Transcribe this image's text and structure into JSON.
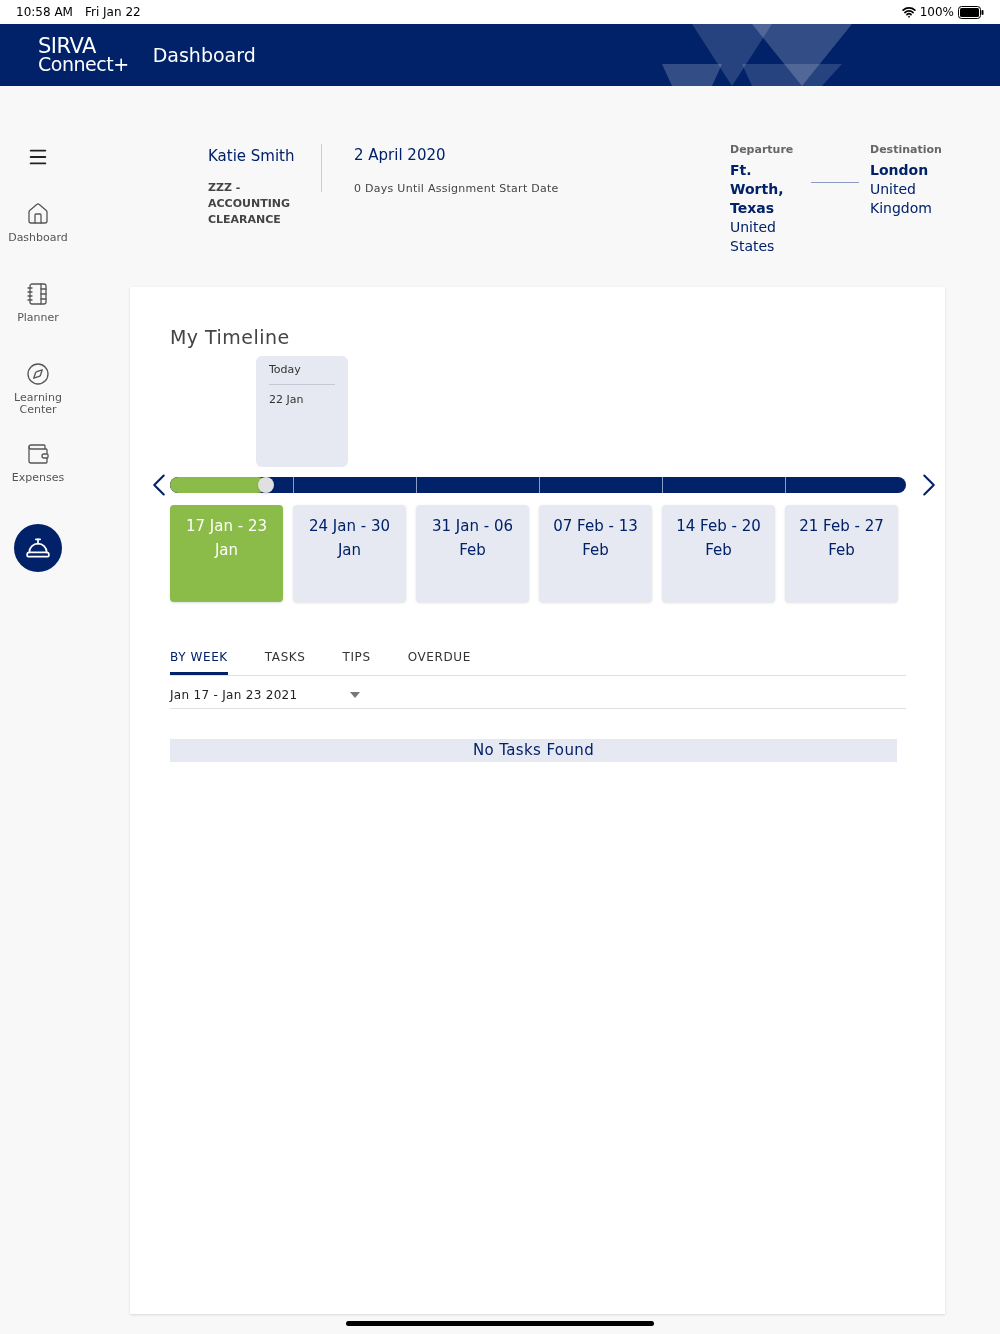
{
  "status_bar": {
    "time": "10:58 AM",
    "date": "Fri Jan 22",
    "battery": "100%"
  },
  "header": {
    "logo_top": "SIRVA",
    "logo_bottom": "Connect+",
    "title": "Dashboard"
  },
  "sidebar": {
    "items": [
      {
        "kind": "home",
        "label": "Dashboard"
      },
      {
        "kind": "planner",
        "label": "Planner"
      },
      {
        "kind": "compass",
        "label": "Learning Center"
      },
      {
        "kind": "wallet",
        "label": "Expenses"
      }
    ]
  },
  "assignment": {
    "name": "Katie Smith",
    "program": "ZZZ - ACCOUNTING CLEARANCE",
    "date": "2 April 2020",
    "countdown": "0 Days Until Assignment Start Date",
    "departure": {
      "label": "Departure",
      "city": "Ft. Worth, Texas",
      "country": "United States"
    },
    "destination": {
      "label": "Destination",
      "city": "London",
      "country": "United Kingdom"
    }
  },
  "timeline": {
    "title": "My Timeline",
    "today_label": "Today",
    "today_date": "22 Jan",
    "level": 0.13,
    "weeks": [
      {
        "label": "17 Jan - 23 Jan",
        "selected": true
      },
      {
        "label": "24 Jan - 30 Jan",
        "selected": false
      },
      {
        "label": "31 Jan - 06 Feb",
        "selected": false
      },
      {
        "label": "07 Feb - 13 Feb",
        "selected": false
      },
      {
        "label": "14 Feb - 20 Feb",
        "selected": false
      },
      {
        "label": "21 Feb - 27 Feb",
        "selected": false
      }
    ],
    "tabs": [
      {
        "label": "BY WEEK",
        "selected": true
      },
      {
        "label": "TASKS",
        "selected": false
      },
      {
        "label": "TIPS",
        "selected": false
      },
      {
        "label": "OVERDUE",
        "selected": false
      }
    ],
    "week_select": "Jan 17 - Jan 23 2021",
    "empty_message": "No Tasks Found"
  }
}
